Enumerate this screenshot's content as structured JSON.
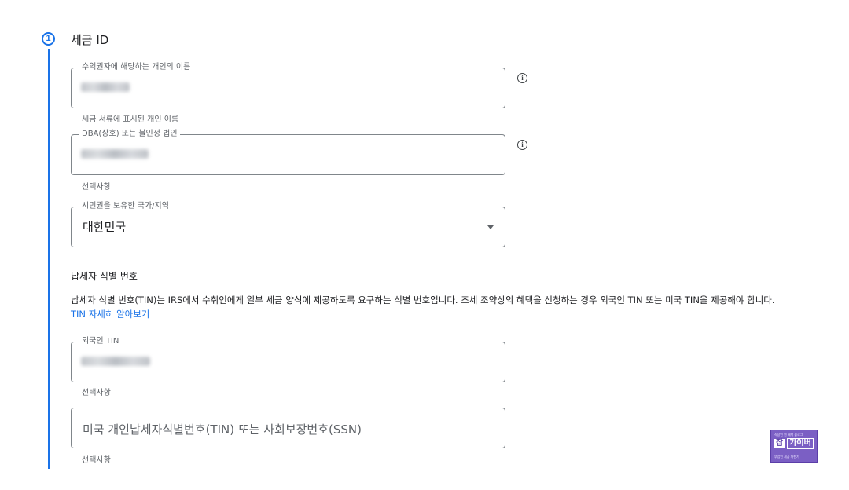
{
  "step": {
    "number": "1",
    "title": "세금 ID"
  },
  "fields": {
    "payee_name": {
      "label": "수익권자에 해당하는 개인의 이름",
      "helper": "세금 서류에 표시된 개인 이름"
    },
    "dba": {
      "label": "DBA(상호) 또는 불인정 법인",
      "helper": "선택사항"
    },
    "country": {
      "label": "시민권을 보유한 국가/지역",
      "value": "대한민국"
    },
    "foreign_tin": {
      "label": "외국인 TIN",
      "helper": "선택사항"
    },
    "us_tin": {
      "placeholder": "미국 개인납세자식별번호(TIN) 또는 사회보장번호(SSN)",
      "helper": "선택사항"
    }
  },
  "tin_section": {
    "heading": "납세자 식별 번호",
    "description": "납세자 식별 번호(TIN)는 IRS에서 수취인에게 일부 세금 양식에 제공하도록 요구하는 식별 번호입니다. 조세 조약상의 혜택을 신청하는 경우 외국인 TIN 또는 미국 TIN을 제공해야 합니다.",
    "link": "TIN 자세히 알아보기"
  },
  "icons": {
    "info": "i",
    "info_icon": "info-icon"
  },
  "badge": {
    "top": "직장인 뭔 혜택 블로그",
    "main1": "잡",
    "main2": "가이버",
    "bottom": "부업인 세금 자판기"
  },
  "colors": {
    "accent": "#1a73e8",
    "border": "#80868b",
    "badge": "#7b5fc4"
  }
}
